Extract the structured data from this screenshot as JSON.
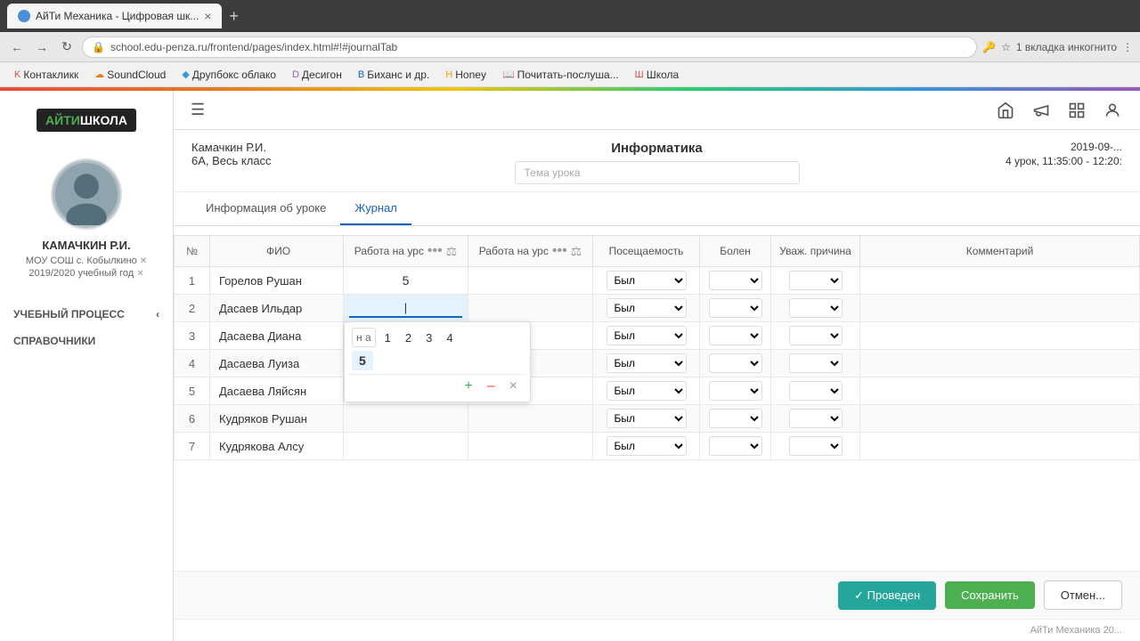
{
  "browser": {
    "tab_title": "АйТи Механика - Цифровая шк...",
    "url": "school.edu-penza.ru/frontend/pages/index.html#!#journalTab",
    "extensions_text": "1 вкладка инкогнито",
    "bookmarks": [
      {
        "label": "Контакликк",
        "icon": "K"
      },
      {
        "label": "SoundCloud",
        "icon": "S"
      },
      {
        "label": "Друпбокс облако",
        "icon": "D"
      },
      {
        "label": "Десигон",
        "icon": "D"
      },
      {
        "label": "Биханс и др.",
        "icon": "B"
      },
      {
        "label": "Honey",
        "icon": "H"
      },
      {
        "label": "Почитать-послушa...",
        "icon": "P"
      },
      {
        "label": "Школа",
        "icon": "Ш"
      }
    ]
  },
  "logo": {
    "text1": "АЙТИ",
    "text2": "ШКОЛА"
  },
  "sidebar": {
    "teacher_name": "КАМАЧКИН Р.И.",
    "school": "МОУ СОШ с. Кобылкино",
    "year": "2019/2020 учебный год",
    "nav": [
      {
        "label": "УЧЕБНЫЙ ПРОЦЕСС"
      },
      {
        "label": "СПРАВОЧНИКИ"
      }
    ]
  },
  "lesson": {
    "teacher": "Камачкин Р.И.",
    "class": "6А, Весь класс",
    "subject": "Информатика",
    "topic_placeholder": "Тема урока",
    "date": "2019-09-...",
    "lesson_num": "4 урок, 11:35:00 - 12:20:"
  },
  "tabs": [
    {
      "label": "Информация об уроке",
      "active": false
    },
    {
      "label": "Журнал",
      "active": true
    }
  ],
  "table": {
    "columns": [
      {
        "label": "№"
      },
      {
        "label": "ФИО"
      },
      {
        "label": "Работа на урс",
        "has_dots": true,
        "has_balance": true
      },
      {
        "label": "Работа на урс",
        "has_dots": true,
        "has_balance": true
      },
      {
        "label": "Посещаемость"
      },
      {
        "label": "Болен"
      },
      {
        "label": "Уваж. причина"
      },
      {
        "label": "Комментарий"
      }
    ],
    "rows": [
      {
        "num": "1",
        "name": "Горелов Рушан",
        "work1": "5",
        "work2": "",
        "attend": "Был",
        "sick": "",
        "reason": "",
        "comment": ""
      },
      {
        "num": "2",
        "name": "Дасаев Ильдар",
        "work1": "",
        "work2": "",
        "attend": "Был",
        "sick": "",
        "reason": "",
        "comment": "",
        "popup": true
      },
      {
        "num": "3",
        "name": "Дасаева Диана",
        "work1": "",
        "work2": "",
        "attend": "Был",
        "sick": "",
        "reason": "",
        "comment": ""
      },
      {
        "num": "4",
        "name": "Дасаева Луиза",
        "work1": "",
        "work2": "",
        "attend": "Был",
        "sick": "",
        "reason": "",
        "comment": ""
      },
      {
        "num": "5",
        "name": "Дасаева Ляйсян",
        "work1": "",
        "work2": "",
        "attend": "Был",
        "sick": "",
        "reason": "",
        "comment": ""
      },
      {
        "num": "6",
        "name": "Кудряков Рушан",
        "work1": "",
        "work2": "",
        "attend": "Был",
        "sick": "",
        "reason": "",
        "comment": ""
      },
      {
        "num": "7",
        "name": "Кудрякова Алсу",
        "work1": "",
        "work2": "",
        "attend": "Был",
        "sick": "",
        "reason": "",
        "comment": ""
      }
    ],
    "grade_popup": {
      "options_row1": [
        "н а",
        "1",
        "2",
        "3",
        "4"
      ],
      "options_row2": [
        "5"
      ],
      "btn_plus": "+",
      "btn_minus": "–",
      "btn_clear": "×"
    }
  },
  "footer": {
    "btn_conducted": "✓ Проведен",
    "btn_save": "Сохранить",
    "btn_cancel": "Отмен...",
    "copyright": "АйТи Механика 20..."
  },
  "top_nav_icons": {
    "home": "🏠",
    "bell": "📢",
    "grid": "⣿"
  }
}
